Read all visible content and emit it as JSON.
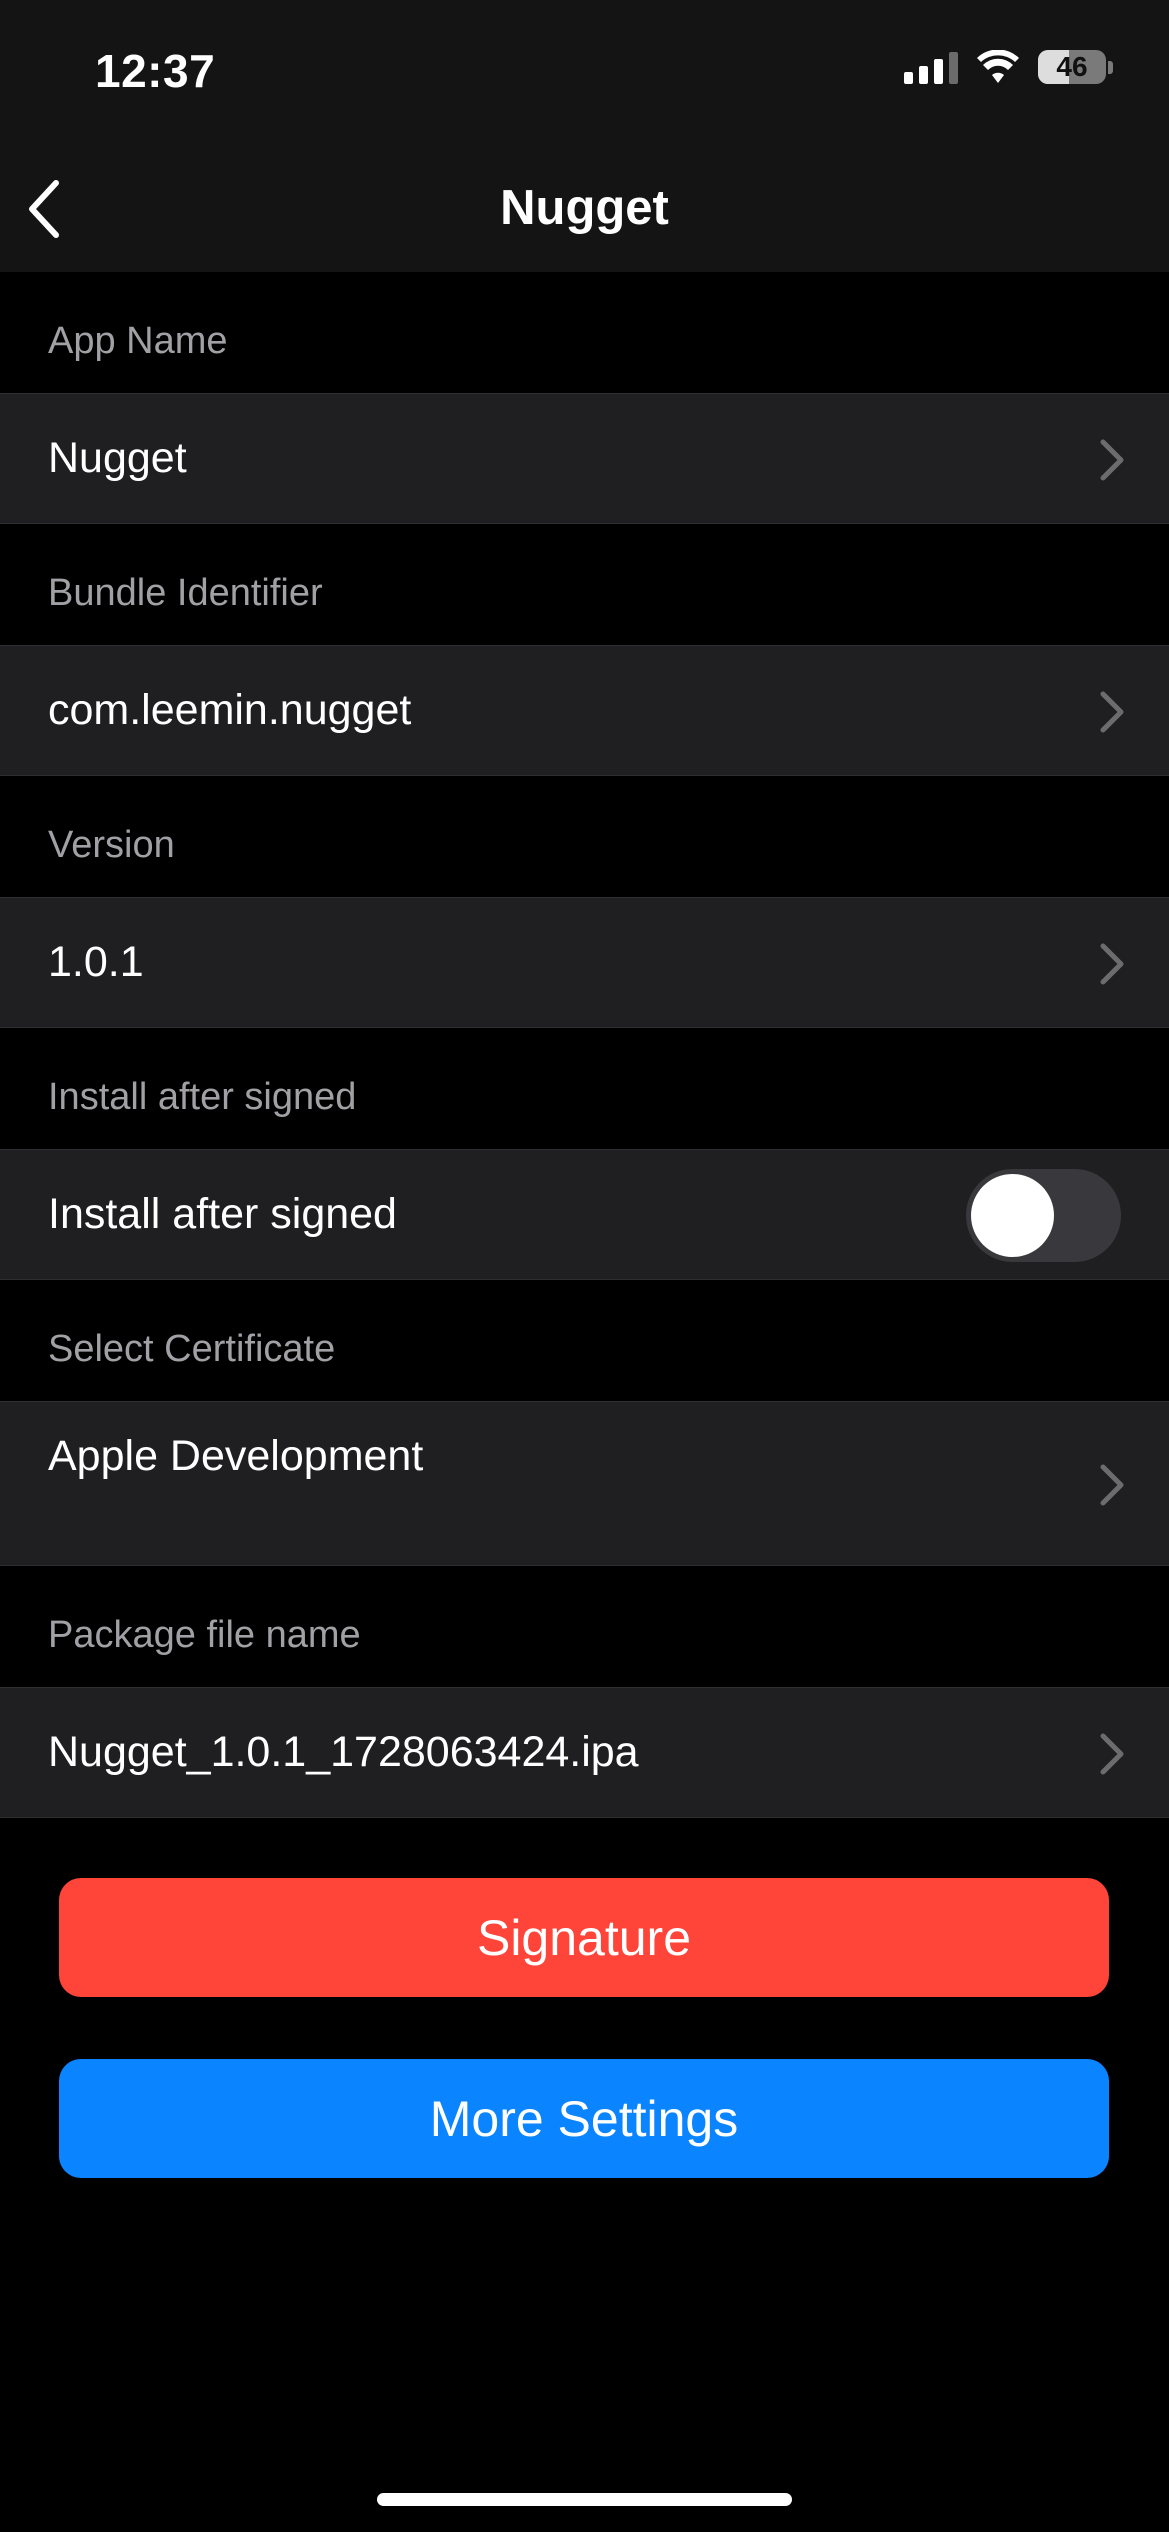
{
  "status_bar": {
    "time": "12:37",
    "battery_level": "46",
    "icons": [
      "cellular-signal-icon",
      "wifi-icon",
      "battery-icon"
    ]
  },
  "nav": {
    "title": "Nugget",
    "back_icon": "chevron-left-icon"
  },
  "sections": [
    {
      "header": "App Name",
      "value": "Nugget",
      "type": "link"
    },
    {
      "header": "Bundle Identifier",
      "value": "com.leemin.nugget",
      "type": "link"
    },
    {
      "header": "Version",
      "value": "1.0.1",
      "type": "link"
    },
    {
      "header": "Install after signed",
      "value": "Install after signed",
      "type": "toggle",
      "toggle_on": false
    },
    {
      "header": "Select Certificate",
      "value": "Apple Development",
      "type": "link"
    },
    {
      "header": "Package file name",
      "value": "Nugget_1.0.1_1728063424.ipa",
      "type": "link"
    }
  ],
  "buttons": {
    "signature": "Signature",
    "more_settings": "More Settings"
  },
  "colors": {
    "background": "#000000",
    "row_background": "#1f1f21",
    "header_text": "#a0a0a5",
    "signature_button": "#ff453a",
    "more_settings_button": "#0a84ff",
    "chevron": "#6c6c70"
  }
}
